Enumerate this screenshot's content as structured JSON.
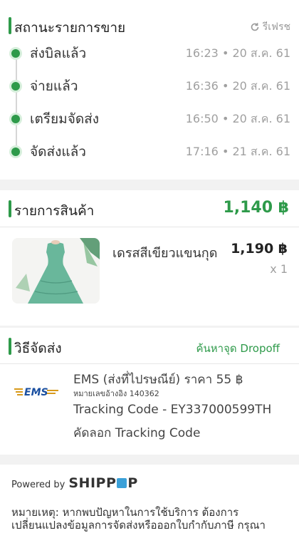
{
  "status": {
    "title": "สถานะรายการขาย",
    "refresh_label": "รีเฟรช",
    "steps": [
      {
        "label": "ส่งบิลแล้ว",
        "time": "16:23 • 20 ส.ค. 61"
      },
      {
        "label": "จ่ายแล้ว",
        "time": "16:36 • 20 ส.ค. 61"
      },
      {
        "label": "เตรียมจัดส่ง",
        "time": "16:50 • 20 ส.ค. 61"
      },
      {
        "label": "จัดส่งแล้ว",
        "time": "17:16 • 21 ส.ค. 61"
      }
    ]
  },
  "items": {
    "title": "รายการสินค้า",
    "total": "1,140 ฿",
    "list": [
      {
        "name": "เดรสสีเขียวแขนกุด",
        "price": "1,190 ฿",
        "qty": "x 1"
      }
    ]
  },
  "shipping": {
    "title": "วิธีจัดส่ง",
    "find_dropoff": "ค้นหาจุด Dropoff",
    "logo_text": "EMS",
    "method": "EMS (ส่งที่ไปรษณีย์) ราคา 55 ฿",
    "ref": "หมายเลขอ้างอิง 140362",
    "tracking": "Tracking Code - EY337000599TH",
    "copy_label": "คัดลอก Tracking Code"
  },
  "footer": {
    "powered_by": "Powered by",
    "brand": [
      "SHIPP",
      "P"
    ],
    "note": "หมายเหตุ: หากพบปัญหาในการใช้บริการ ต้องการเปลี่ยนแปลงข้อมูลการจัดส่งหรือออกใบกำกับภาษี กรุณา"
  },
  "colors": {
    "accent": "#2e9a4a",
    "muted": "#9a9a9a"
  }
}
